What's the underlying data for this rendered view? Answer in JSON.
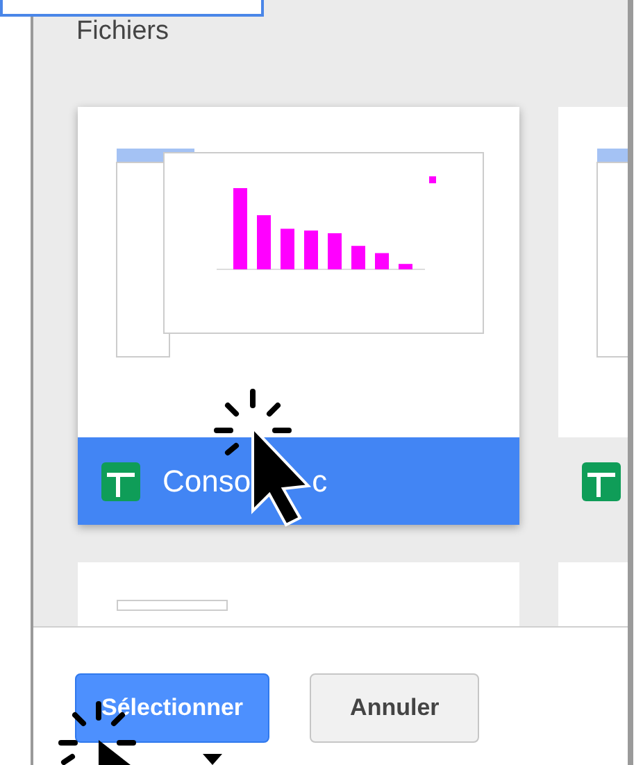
{
  "section_title": "Fichiers",
  "files": [
    {
      "kind": "picture",
      "title": "Conso",
      "title_end": "c",
      "selected": true
    },
    {
      "kind": "picture",
      "selected": false
    }
  ],
  "buttons": [
    {
      "label": "Sélectionner",
      "kind": "primary"
    },
    {
      "label": "Annuler",
      "kind": "secondary"
    }
  ]
}
